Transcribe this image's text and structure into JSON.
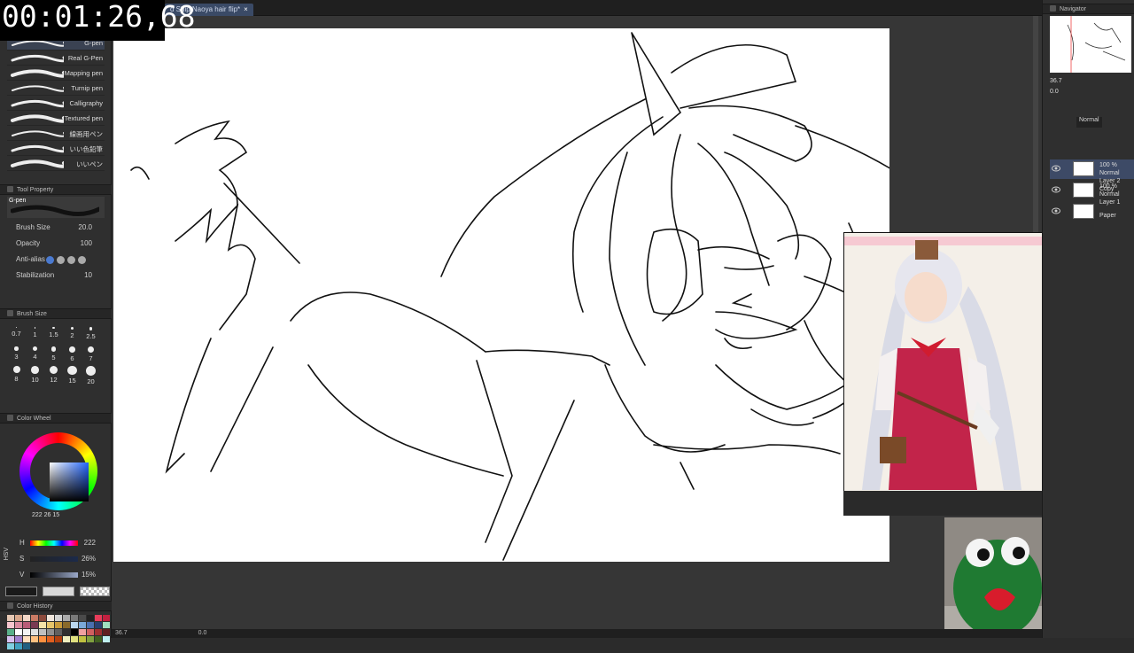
{
  "timer": "00:01:26,68",
  "document_tab": {
    "title": "d Ship Naoya hair flip*",
    "close": "×"
  },
  "brushes": [
    {
      "label": "G-pen",
      "selected": true
    },
    {
      "label": "Real G-Pen",
      "selected": false
    },
    {
      "label": "Mapping pen",
      "selected": false
    },
    {
      "label": "Turnip pen",
      "selected": false
    },
    {
      "label": "Calligraphy",
      "selected": false
    },
    {
      "label": "Textured pen",
      "selected": false
    },
    {
      "label": "線画用ペン",
      "selected": false
    },
    {
      "label": "いい色鉛筆",
      "selected": false
    },
    {
      "label": "いいペン",
      "selected": false
    }
  ],
  "tool_property": {
    "title": "Tool Property",
    "tool_name": "G-pen",
    "brush_size_label": "Brush Size",
    "brush_size_value": "20.0",
    "opacity_label": "Opacity",
    "opacity_value": "100",
    "antialias_label": "Anti-alias",
    "stabilization_label": "Stabilization",
    "stabilization_value": "10"
  },
  "brush_size_palette": {
    "title": "Brush Size",
    "sizes": [
      "0.7",
      "1",
      "1.5",
      "2",
      "2.5",
      "3",
      "4",
      "5",
      "6",
      "7",
      "8",
      "10",
      "12",
      "15",
      "20"
    ]
  },
  "color_wheel": {
    "title": "Color Wheel",
    "rgb_values": [
      "222",
      "26",
      "15"
    ]
  },
  "hsv": {
    "h_label": "H",
    "h_value": "222",
    "s_label": "S",
    "s_value": "26%",
    "v_label": "V",
    "v_value": "15%",
    "mode_label": "HSV"
  },
  "color_history": {
    "title": "Color History",
    "colors": [
      "#e6c8b4",
      "#d9a88c",
      "#f2d6c6",
      "#c97a64",
      "#8c4a3c",
      "#f0e6dc",
      "#d2d2d2",
      "#aaaaaa",
      "#7a7a7a",
      "#4a4a4a",
      "#222222",
      "#e83c5a",
      "#c22040",
      "#f7c6cf",
      "#d98aa0",
      "#b85c78",
      "#7a3a52",
      "#f6e3a8",
      "#e6c46a",
      "#c89a3a",
      "#8a6a2a",
      "#bcd8f0",
      "#7aa8d8",
      "#4a70b0",
      "#2a4070",
      "#a0e0c0",
      "#5ab08a",
      "#ffffff",
      "#f4f4f4",
      "#e0e0e0",
      "#c0c0c0",
      "#909090",
      "#606060",
      "#303030",
      "#000000",
      "#f0a0a0",
      "#d06060",
      "#a03030",
      "#602020",
      "#d8c0f0",
      "#a080d0",
      "#ffe0c0",
      "#ffc080",
      "#ff9040",
      "#e06020",
      "#b04010",
      "#f0f0c0",
      "#e0e080",
      "#c0c040",
      "#80a040",
      "#406020",
      "#c0f0f0",
      "#80d0e0",
      "#40a0c0",
      "#206080"
    ]
  },
  "navigator": {
    "title": "Navigator",
    "zoom": "36.7",
    "rotation": "0.0"
  },
  "layers": {
    "blend_mode": "Normal",
    "items": [
      {
        "opacity": "100 % Normal",
        "name": "Layer 2 Copy",
        "selected": true
      },
      {
        "opacity": "100 % Normal",
        "name": "Layer 1",
        "selected": false
      },
      {
        "opacity": "",
        "name": "Paper",
        "selected": false
      }
    ]
  },
  "statusbar": {
    "zoom": "36.7",
    "angle": "0.0"
  },
  "colors": {
    "panel_bg": "#2f2f2f",
    "canvas_bg": "#ffffff",
    "accent": "#3d4a66"
  }
}
